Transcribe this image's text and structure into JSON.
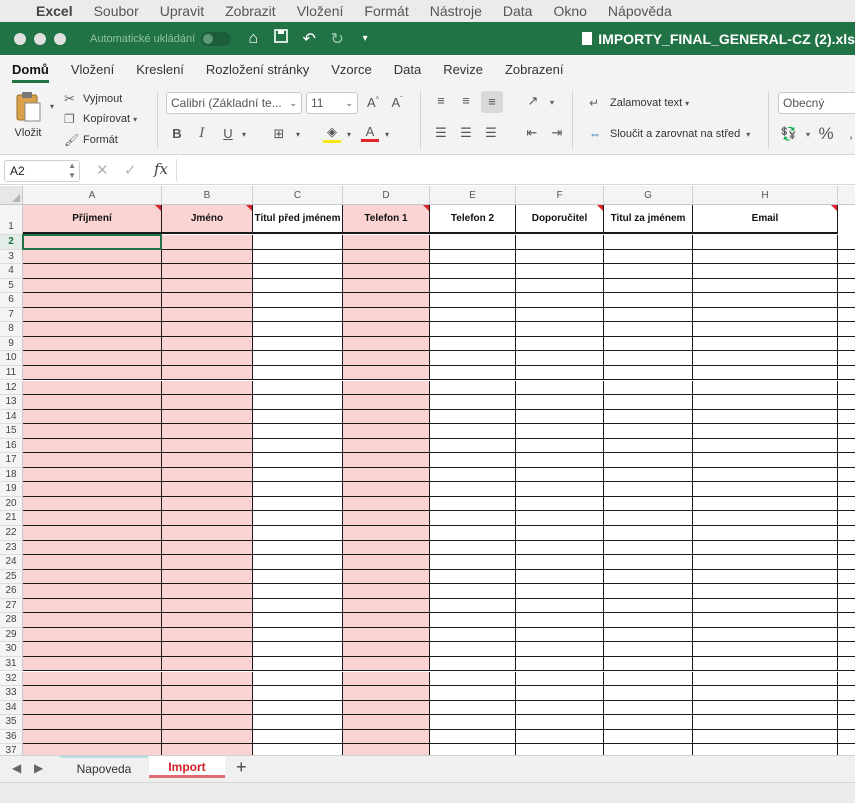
{
  "menubar": {
    "app": "Excel",
    "items": [
      "Soubor",
      "Upravit",
      "Zobrazit",
      "Vložení",
      "Formát",
      "Nástroje",
      "Data",
      "Okno",
      "Nápověda"
    ]
  },
  "titlebar": {
    "autosave_label": "Automatické ukládání",
    "autosave_state": "O",
    "doc_title": "IMPORTY_FINAL_GENERAL-CZ (2).xls"
  },
  "ribbon_tabs": [
    "Domů",
    "Vložení",
    "Kreslení",
    "Rozložení stránky",
    "Vzorce",
    "Data",
    "Revize",
    "Zobrazení"
  ],
  "ribbon": {
    "paste": "Vložit",
    "cut": "Vyjmout",
    "copy": "Kopírovat",
    "format_painter": "Formát",
    "font_name": "Calibri (Základní te...",
    "font_size": "11",
    "bold": "B",
    "italic": "I",
    "underline": "U",
    "wrap_text": "Zalamovat text",
    "merge_center": "Sloučit a zarovnat na střed",
    "number_format": "Obecný",
    "percent": "%"
  },
  "formula_bar": {
    "name_box": "A2",
    "fx": "fx",
    "formula": ""
  },
  "columns": [
    "A",
    "B",
    "C",
    "D",
    "E",
    "F",
    "G",
    "H"
  ],
  "header_row": [
    "Příjmení",
    "Jméno",
    "Titul před jménem",
    "Telefon 1",
    "Telefon 2",
    "Doporučitel",
    "Titul za jménem",
    "Email"
  ],
  "required_columns": [
    true,
    true,
    false,
    true,
    false,
    false,
    false,
    false
  ],
  "comment_marker_columns": [
    true,
    true,
    false,
    true,
    false,
    true,
    false,
    true
  ],
  "row_numbers": [
    "1",
    "2",
    "3",
    "4",
    "5",
    "6",
    "7",
    "8",
    "9",
    "10",
    "11",
    "12",
    "13",
    "14",
    "15",
    "16",
    "17",
    "18",
    "19",
    "20",
    "21",
    "22",
    "23",
    "24",
    "25",
    "26",
    "27",
    "28",
    "29",
    "30",
    "31",
    "32",
    "33",
    "34",
    "35",
    "36",
    "37"
  ],
  "selected_row": "2",
  "sheet_tabs": [
    "Napoveda",
    "Import"
  ],
  "active_sheet": "Import",
  "colors": {
    "excel_green": "#217346",
    "required_fill": "#fbd3d3",
    "comment_marker": "#d9262a",
    "active_tab_text": "#d11f26"
  }
}
